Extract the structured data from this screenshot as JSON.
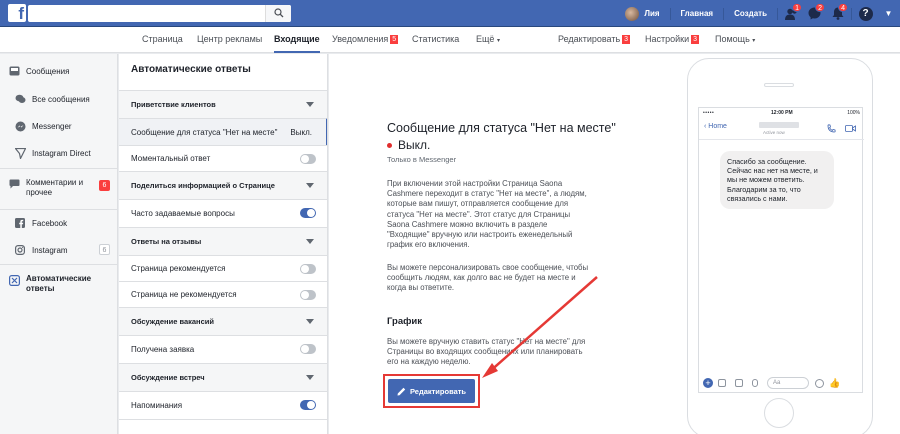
{
  "topbar": {
    "logo": "f",
    "user_name": "Лия",
    "home_label": "Главная",
    "create_label": "Создать",
    "friends_badge": "1",
    "messages_badge": "2",
    "notifications_badge": "4",
    "help_glyph": "?"
  },
  "page_tabs": {
    "page": "Страница",
    "ad_center": "Центр рекламы",
    "inbox": "Входящие",
    "notifications": "Уведомления",
    "notifications_badge": "5",
    "insights": "Статистика",
    "more": "Ещё",
    "edit": "Редактировать",
    "edit_badge": "3",
    "settings": "Настройки",
    "settings_badge": "3",
    "help": "Помощь"
  },
  "sidebar": {
    "messages": "Сообщения",
    "all_messages": "Все сообщения",
    "messenger": "Messenger",
    "instagram_direct": "Instagram Direct",
    "comments": "Комментарии и прочее",
    "comments_badge": "6",
    "facebook": "Facebook",
    "instagram": "Instagram",
    "instagram_badge": "6",
    "auto_replies": "Автоматические ответы"
  },
  "settings": {
    "title": "Автоматические ответы",
    "greeting_section": "Приветствие клиентов",
    "away_message": "Сообщение для статуса \"Нет на месте\"",
    "away_value": "Выкл.",
    "instant_reply": "Моментальный ответ",
    "share_info_section": "Поделиться информацией о Странице",
    "faq": "Часто задаваемые вопросы",
    "reviews_section": "Ответы на отзывы",
    "page_recommended": "Страница рекомендуется",
    "page_not_recommended": "Страница не рекомендуется",
    "jobs_section": "Обсуждение вакансий",
    "application_received": "Получена заявка",
    "meetings_section": "Обсуждение встреч",
    "reminders": "Напоминания"
  },
  "main": {
    "title": "Сообщение для статуса \"Нет на месте\"",
    "status": "Выкл.",
    "only_messenger": "Только в Messenger",
    "paragraph1": "При включении этой настройки Страница Saona Cashmere переходит в статус \"Нет на месте\", а людям, которые вам пишут, отправляется сообщение для статуса \"Нет на месте\". Этот статус для Страницы Saona Cashmere можно включить в разделе \"Входящие\" вручную или настроить еженедельный график его включения.",
    "paragraph2": "Вы можете персонализировать свое сообщение, чтобы сообщить людям, как долго вас не будет на месте и когда вы ответите.",
    "schedule_title": "График",
    "paragraph3": "Вы можете вручную ставить статус \"Нет на месте\" для Страницы во входящих сообщениях или планировать его на каждую неделю.",
    "edit_button": "Редактировать"
  },
  "phone": {
    "signal": "•••••",
    "time": "12:00 PM",
    "battery": "100%",
    "back": "Home",
    "active_text": "Active now",
    "bubble": "Спасибо за сообщение. Сейчас нас нет на месте, и мы не можем ответить. Благодарим за то, что связались с нами.",
    "input_placeholder": "Aa",
    "plus": "+"
  },
  "colors": {
    "brand": "#4267b2",
    "badge": "#fa3e3e",
    "annotation": "#e53935"
  }
}
